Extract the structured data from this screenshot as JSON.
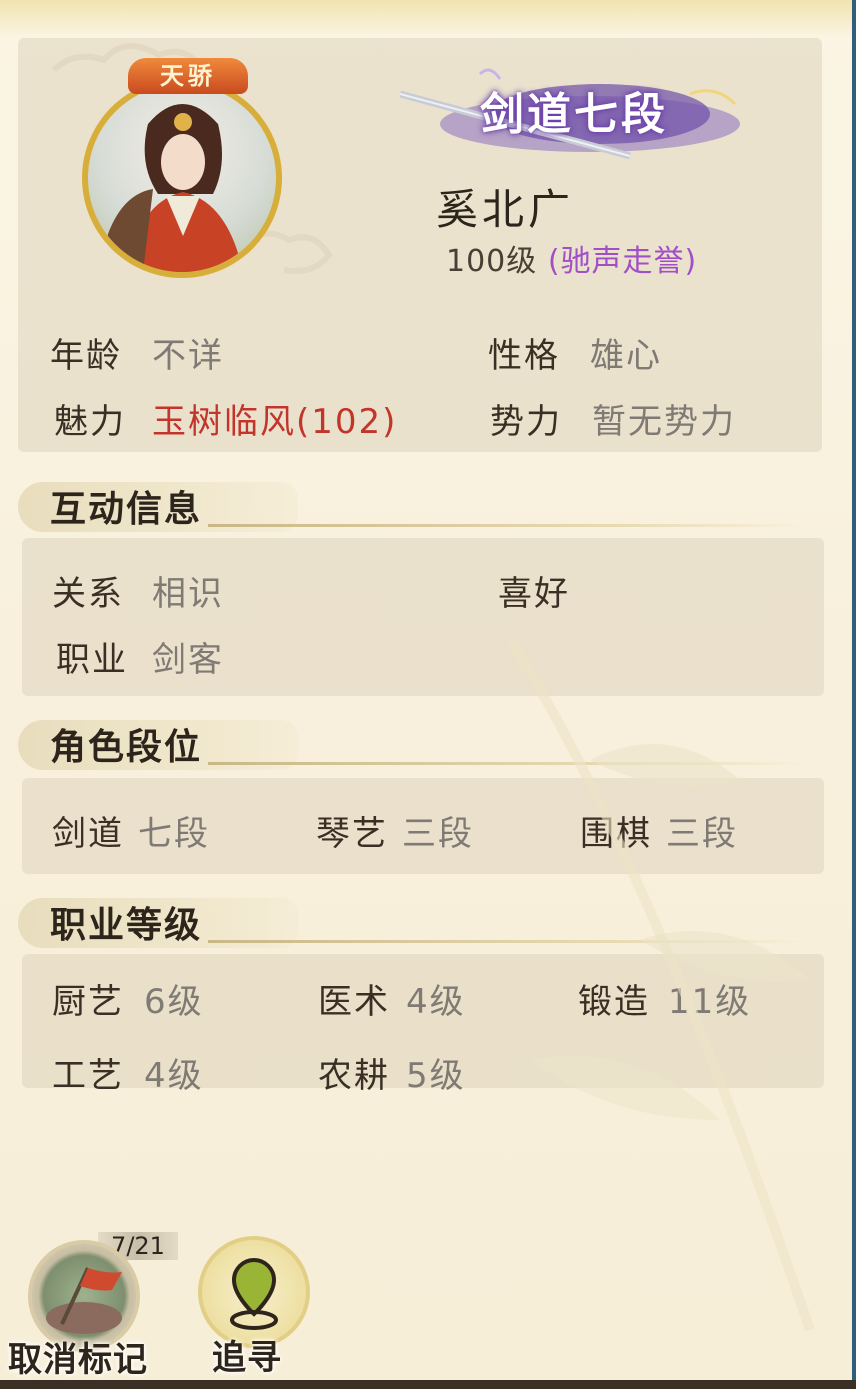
{
  "character": {
    "badge": "天骄",
    "rank_title": "剑道七段",
    "name": "奚北广",
    "level": "100级",
    "title": "(驰声走誉)"
  },
  "basic_info": {
    "age_label": "年龄",
    "age_value": "不详",
    "personality_label": "性格",
    "personality_value": "雄心",
    "charm_label": "魅力",
    "charm_value": "玉树临风(102)",
    "faction_label": "势力",
    "faction_value": "暂无势力"
  },
  "interaction": {
    "section_title": "互动信息",
    "relation_label": "关系",
    "relation_value": "相识",
    "hobby_label": "喜好",
    "job_label": "职业",
    "job_value": "剑客"
  },
  "ranks": {
    "section_title": "角色段位",
    "items": [
      {
        "label": "剑道",
        "value": "七段"
      },
      {
        "label": "琴艺",
        "value": "三段"
      },
      {
        "label": "围棋",
        "value": "三段"
      }
    ]
  },
  "professions": {
    "section_title": "职业等级",
    "items": [
      {
        "label": "厨艺",
        "value": "6级"
      },
      {
        "label": "医术",
        "value": "4级"
      },
      {
        "label": "锻造",
        "value": "11级"
      },
      {
        "label": "工艺",
        "value": "4级"
      },
      {
        "label": "农耕",
        "value": "5级"
      }
    ]
  },
  "actions": {
    "counter": "7/21",
    "unmark_label": "取消标记",
    "track_label": "追寻"
  },
  "colors": {
    "background": "#f8f0dc",
    "panel": "#e2d7c0",
    "label": "#3b2f25",
    "value": "#7f7a74",
    "charm_red": "#c2352b",
    "title_purple": "#a14fc8",
    "avatar_gold": "#d8ae3a"
  }
}
